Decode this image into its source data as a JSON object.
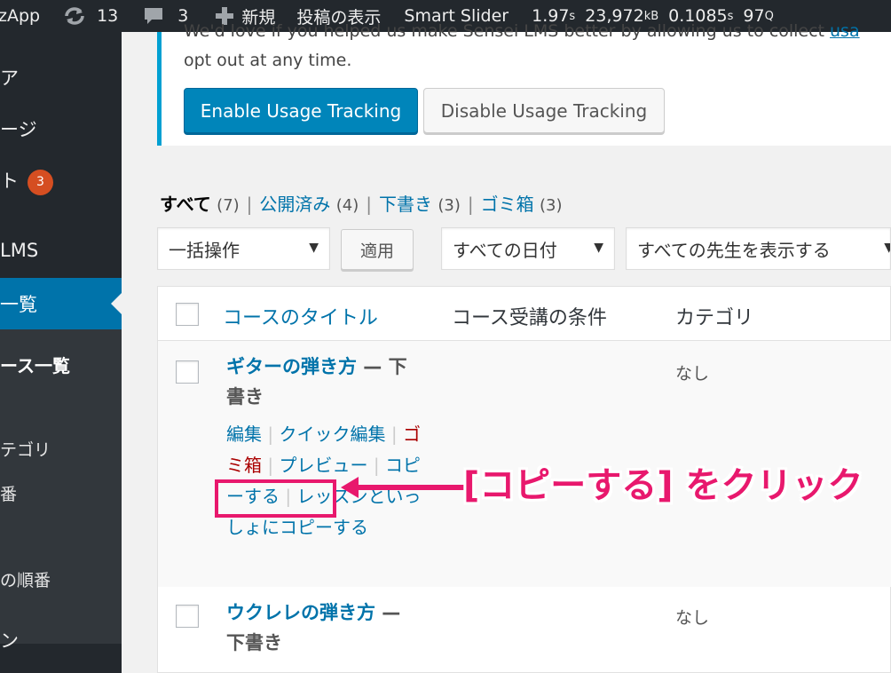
{
  "admin_bar": {
    "site_name": "zApp",
    "updates_count": "13",
    "comments_count": "3",
    "new_label": "新規",
    "view_posts_label": "投稿の表示",
    "smart_slider_label": "Smart Slider",
    "perf_time": "1.97",
    "perf_time_unit": "s",
    "perf_memory": "23,972",
    "perf_memory_unit": "kB",
    "perf_query_time": "0.1085",
    "perf_query_time_unit": "s",
    "perf_queries": "97",
    "perf_queries_unit": "Q"
  },
  "sidebar": {
    "item1": "ア",
    "item2": "ージ",
    "item3": "ト",
    "item3_badge": "3",
    "item4": "LMS",
    "current": "一覧",
    "sub_current": "ース一覧",
    "sub2": "テゴリ",
    "sub3": "番",
    "sub4": "の順番",
    "item5": "ン"
  },
  "notice": {
    "line1_partial": "We'd love if you helped us make Sensei LMS better by allowing us to collect ",
    "line1_link": "usa",
    "line2": "opt out at any time.",
    "enable_button": "Enable Usage Tracking",
    "disable_button": "Disable Usage Tracking"
  },
  "filters": {
    "all_label": "すべて",
    "all_count": "(7)",
    "published_label": "公開済み",
    "published_count": "(4)",
    "drafts_label": "下書き",
    "drafts_count": "(3)",
    "trash_label": "ゴミ箱",
    "trash_count": "(3)",
    "separator": "|",
    "bulk_action": "一括操作",
    "apply_button": "適用",
    "date_filter": "すべての日付",
    "teacher_filter": "すべての先生を表示する"
  },
  "table": {
    "headers": {
      "title": "コースのタイトル",
      "prerequisite": "コース受講の条件",
      "category": "カテゴリ"
    },
    "rows": [
      {
        "title": "ギターの弾き方",
        "state": " — 下書き",
        "category": "なし",
        "actions": {
          "edit": "編集",
          "quick_edit": "クイック編集",
          "trash": "ゴミ箱",
          "preview": "プレビュー",
          "duplicate": "コピーする",
          "duplicate_with_lessons": "レッスンといっしょにコピーする"
        }
      },
      {
        "title": "ウクレレの弾き方",
        "state": " — 下書き",
        "category": "なし"
      }
    ]
  },
  "annotation": {
    "text": "[コピーする] をクリック",
    "color": "#e8186d"
  },
  "colors": {
    "admin_bar": "#23282d",
    "accent": "#0073aa",
    "primary_button": "#0085ba",
    "badge": "#d54e21"
  }
}
